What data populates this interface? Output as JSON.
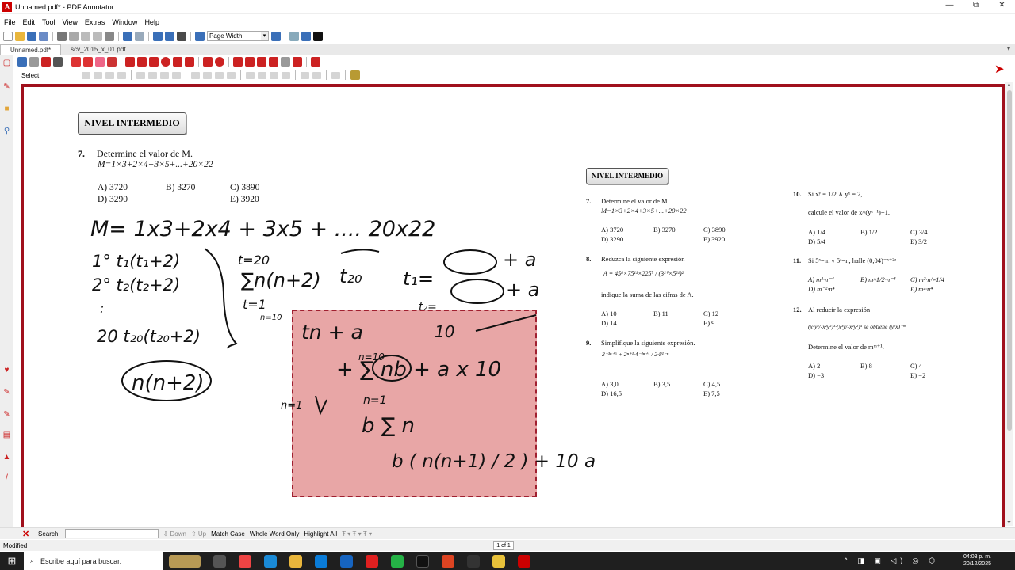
{
  "window": {
    "title": "Unnamed.pdf* - PDF Annotator",
    "minimize": "—",
    "restore": "⧉",
    "close": "✕"
  },
  "menu": [
    "File",
    "Edit",
    "Tool",
    "View",
    "Extras",
    "Window",
    "Help"
  ],
  "toolbar": {
    "zoom_mode": "Page Width"
  },
  "tabs": [
    {
      "label": "Unnamed.pdf*",
      "active": true
    },
    {
      "label": "scv_2015_x_01.pdf",
      "active": false
    }
  ],
  "tool_label": "Select",
  "page_left": {
    "nivel": "NIVEL INTERMEDIO",
    "q7_num": "7.",
    "q7_text": "Determine el valor de M.",
    "q7_expr": "M=1×3+2×4+3×5+...+20×22",
    "options": [
      "A) 3720",
      "B) 3270",
      "C) 3890",
      "D) 3290",
      "E) 3920"
    ]
  },
  "page_right": {
    "nivel": "NIVEL INTERMEDIO",
    "col1": [
      {
        "num": "7.",
        "lines": [
          "Determine el valor de M.",
          "M=1×3+2×4+3×5+...+20×22"
        ],
        "opts": [
          "A) 3720",
          "B) 3270",
          "C) 3890",
          "D) 3290",
          "E) 3920"
        ]
      },
      {
        "num": "8.",
        "lines": [
          "Reduzca la siguiente expresión",
          "A = 45⁸×75¹¹×225⁷ / (3²⁰×5²¹)²",
          "indique la suma de las cifras de A."
        ],
        "opts": [
          "A) 10",
          "B) 11",
          "C) 12",
          "D) 14",
          "E) 9"
        ]
      },
      {
        "num": "9.",
        "lines": [
          "Simplifique la siguiente expresión.",
          "2⁻³ⁿ⁺⁶ + 2ⁿ⁺¹·4⁻²ⁿ⁺¹ / 2·8¹⁻ⁿ"
        ],
        "opts": [
          "A) 3,0",
          "B) 3,5",
          "C) 4,5",
          "D) 16,5",
          "E) 7,5"
        ]
      }
    ],
    "col2": [
      {
        "num": "10.",
        "lines": [
          "Si xʸ = 1/2 ∧ yˣ = 2,",
          "calcule el valor de x^(yˣ⁺¹)+1."
        ],
        "opts": [
          "A) 1/4",
          "B) 1/2",
          "C) 3/4",
          "D) 5/4",
          "E) 3/2"
        ]
      },
      {
        "num": "11.",
        "lines": [
          "Si 5ˣ=m y 5ᶻ=n, halle (0,04)⁻ˣ⁺²ᶻ"
        ],
        "opts": [
          "A) m²·n⁻⁴",
          "B) m^1/2·n⁻⁴",
          "C) m²·n^-1/4",
          "D) m⁻²·n⁴",
          "E) m²·n⁴"
        ]
      },
      {
        "num": "12.",
        "lines": [
          "Al reducir la expresión",
          "(x³y²/-x²y²)³·(x³y/-x²y²)⁵ se obtiene (y/x)⁻ᵐ",
          "Determine el valor de mᵐ⁺¹."
        ],
        "opts": [
          "A) 2",
          "B) 8",
          "C) 4",
          "D) −3",
          "E) −2"
        ]
      }
    ]
  },
  "handwriting": {
    "line1": "M= 1x3+2x4 + 3x5 + .... 20x22",
    "list": [
      "1°  t₁(t₁+2)",
      "2°  t₂(t₂+2)",
      ":",
      "20  t₂₀(t₂₀+2)"
    ],
    "sum1": "t=20",
    "sum2": "∑n(n+2)",
    "sum3": "t=1",
    "t20": "t₂₀",
    "t1a": "t₁=",
    "a1": "+ a",
    "a2": "+ a",
    "t2": "t₂=",
    "ten": "10",
    "n10": "n=10",
    "circle": "n(n+2)",
    "box1": "tn  + a",
    "box2": "+ ∑ nb  + a x 10",
    "box3": "n=10",
    "box4": "n=1",
    "box5": "b ∑ n",
    "box6": "b ( n(n+1) / 2 )  + 10 a",
    "n1arrow": "n=1"
  },
  "search": {
    "label": "Search:",
    "down": "Down",
    "up": "Up",
    "match_case": "Match Case",
    "whole_word": "Whole Word Only",
    "highlight_all": "Highlight All"
  },
  "status": {
    "left": "Modified",
    "page": "1 of 1"
  },
  "taskbar": {
    "search_placeholder": "Escribe aquí para buscar.",
    "time": "04:03 p. m.",
    "date": "20/12/2025"
  }
}
